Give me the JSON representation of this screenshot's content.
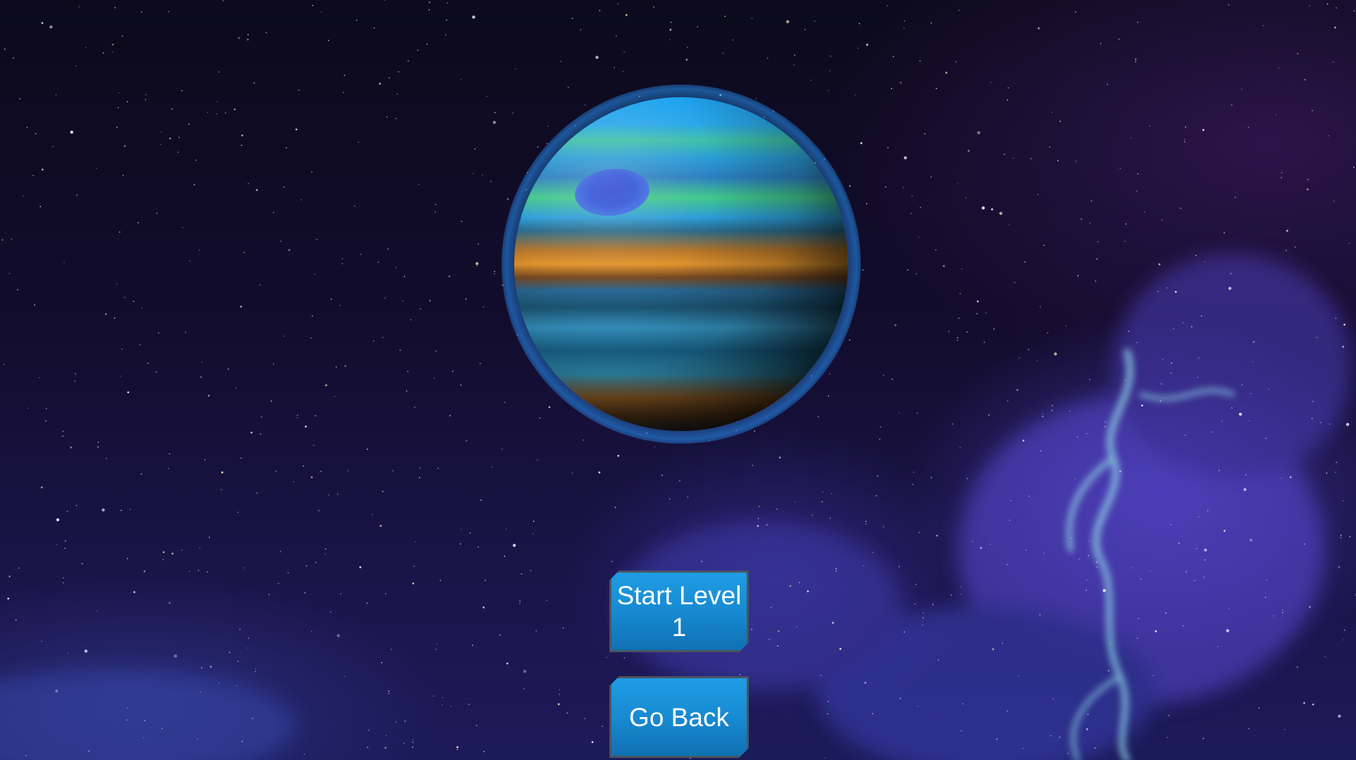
{
  "menu": {
    "start_label": "Start Level 1",
    "back_label": "Go Back"
  },
  "colors": {
    "button_fill": "#1788cf",
    "button_border": "#4a5560",
    "button_text": "#ffffff",
    "background": "#120c2c",
    "planet_glow": "#2896ff"
  },
  "icons": [
    "planet-icon"
  ]
}
